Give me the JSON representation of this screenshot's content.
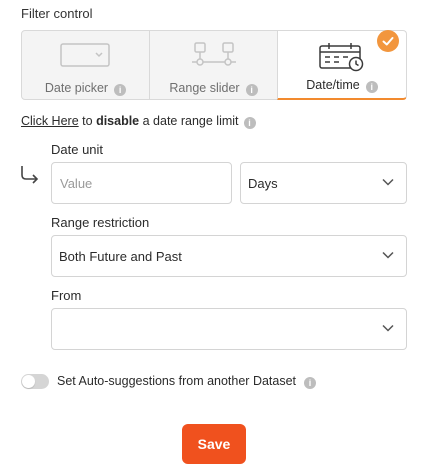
{
  "section": {
    "title": "Filter control"
  },
  "filter_types": [
    {
      "label": "Date picker",
      "icon": "date-picker-icon",
      "selected": false
    },
    {
      "label": "Range slider",
      "icon": "range-slider-icon",
      "selected": false
    },
    {
      "label": "Date/time",
      "icon": "calendar-clock-icon",
      "selected": true
    }
  ],
  "disable_limit": {
    "link_text": "Click Here",
    "to_text": "to",
    "bold_text": "disable",
    "rest_text": "a date range limit"
  },
  "date_unit": {
    "label": "Date unit",
    "value_placeholder": "Value",
    "unit_selected": "Days"
  },
  "range_restriction": {
    "label": "Range restriction",
    "selected": "Both Future and Past"
  },
  "from": {
    "label": "From",
    "selected": ""
  },
  "auto_suggestions": {
    "label": "Set Auto-suggestions from another Dataset",
    "enabled": false
  },
  "save_button": {
    "label": "Save"
  },
  "colors": {
    "accent": "#f28a2e",
    "save": "#f0511e",
    "border": "#d4d4d4"
  }
}
